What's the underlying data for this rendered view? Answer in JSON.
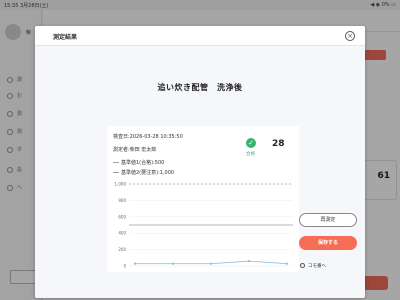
{
  "status_bar": {
    "time": "15:35  3月28日(土)",
    "right": "◀ ◉ 0% ▭"
  },
  "background": {
    "user_name": "柴",
    "nav_items": [
      "測",
      "お",
      "測",
      "測",
      "ダ",
      "設",
      "ヘ"
    ],
    "card_value": "61"
  },
  "modal": {
    "title": "測定結果",
    "close_icon": "×",
    "location": "追い炊き配管　洗浄後",
    "result": {
      "date_line": "検査日:2026-03-28 10:35:50",
      "inspector_line": "測定者:柴田 宏太郎",
      "pass_label": "合格",
      "check_glyph": "✓",
      "score": "28",
      "std1": "基準値1(合格):500",
      "std2": "基準値2(要注意):1,000",
      "std1_color": "#9e9e9e",
      "std2_color": "#9e9e9e"
    },
    "buttons": {
      "remeasure": "再測定",
      "save": "保存する"
    },
    "next_option": "コモ番へ"
  },
  "chart_data": {
    "type": "line",
    "x": [
      1,
      2,
      3,
      4,
      5
    ],
    "series": [
      {
        "values": [
          28,
          28,
          28,
          60,
          28
        ],
        "color": "#8ec3ea"
      }
    ],
    "ylim": [
      0,
      1000
    ],
    "yticks": [
      "1,000",
      "900",
      "600",
      "400",
      "200",
      "0"
    ],
    "reference_lines": [
      {
        "value": 1000,
        "style": "dashed",
        "color": "#9e9e9e"
      },
      {
        "value": 500,
        "style": "solid",
        "color": "#9e9e9e"
      }
    ],
    "grid": true
  }
}
